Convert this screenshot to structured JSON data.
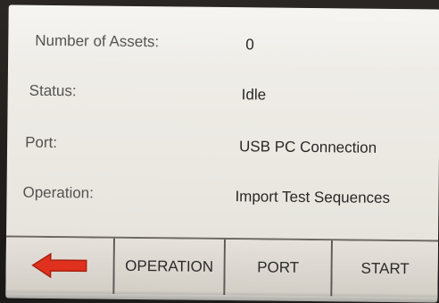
{
  "fields": [
    {
      "label": "Number of Assets:",
      "value": "0"
    },
    {
      "label": "Status:",
      "value": "Idle"
    },
    {
      "label": "Port:",
      "value": "USB PC Connection"
    },
    {
      "label": "Operation:",
      "value": "Import Test Sequences"
    }
  ],
  "toolbar": {
    "back_icon": "left-arrow-icon",
    "back_color": "#e0301e",
    "operation_label": "OPERATION",
    "port_label": "PORT",
    "start_label": "START"
  }
}
